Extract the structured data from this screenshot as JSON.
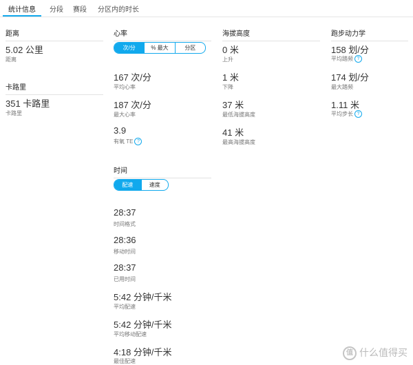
{
  "tabs": [
    {
      "label": "统计信息"
    },
    {
      "label": "分段"
    },
    {
      "label": "赛段"
    },
    {
      "label": "分区内的时长"
    }
  ],
  "distance": {
    "title": "距离",
    "value": "5.02 公里",
    "label": "距离"
  },
  "calories": {
    "title": "卡路里",
    "value": "351 卡路里",
    "label": "卡路里"
  },
  "heart_rate": {
    "title": "心率",
    "toggle": [
      "次/分",
      "% 最大",
      "分区"
    ],
    "toggle_selected": "次/分",
    "stats": [
      {
        "value": "167 次/分",
        "label": "平均心率"
      },
      {
        "value": "187 次/分",
        "label": "最大心率"
      },
      {
        "value": "3.9",
        "label": "有氧 TE"
      }
    ]
  },
  "time": {
    "title": "时间",
    "toggle": [
      "配速",
      "速度"
    ],
    "toggle_selected": "配速",
    "stats": [
      {
        "value": "28:37",
        "label": "时间格式"
      },
      {
        "value": "28:36",
        "label": "移动时间"
      },
      {
        "value": "28:37",
        "label": "已用时间"
      },
      {
        "value": "5:42 分钟/千米",
        "label": "平均配速"
      },
      {
        "value": "5:42 分钟/千米",
        "label": "平均移动配速"
      },
      {
        "value": "4:18 分钟/千米",
        "label": "最佳配速"
      }
    ]
  },
  "elevation": {
    "title": "海拔高度",
    "stats": [
      {
        "value": "0 米",
        "label": "上升"
      },
      {
        "value": "1 米",
        "label": "下降"
      },
      {
        "value": "37 米",
        "label": "最低海拔高度"
      },
      {
        "value": "41 米",
        "label": "最高海拔高度"
      }
    ]
  },
  "running_dynamics": {
    "title": "跑步动力学",
    "stats": [
      {
        "value": "158 划/分",
        "label": "平均踏频"
      },
      {
        "value": "174 划/分",
        "label": "最大踏频"
      },
      {
        "value": "1.11 米",
        "label": "平均步长"
      }
    ]
  },
  "watermark": {
    "logo": "值",
    "text": "什么值得买"
  },
  "colors": {
    "accent": "#11a9ed"
  }
}
